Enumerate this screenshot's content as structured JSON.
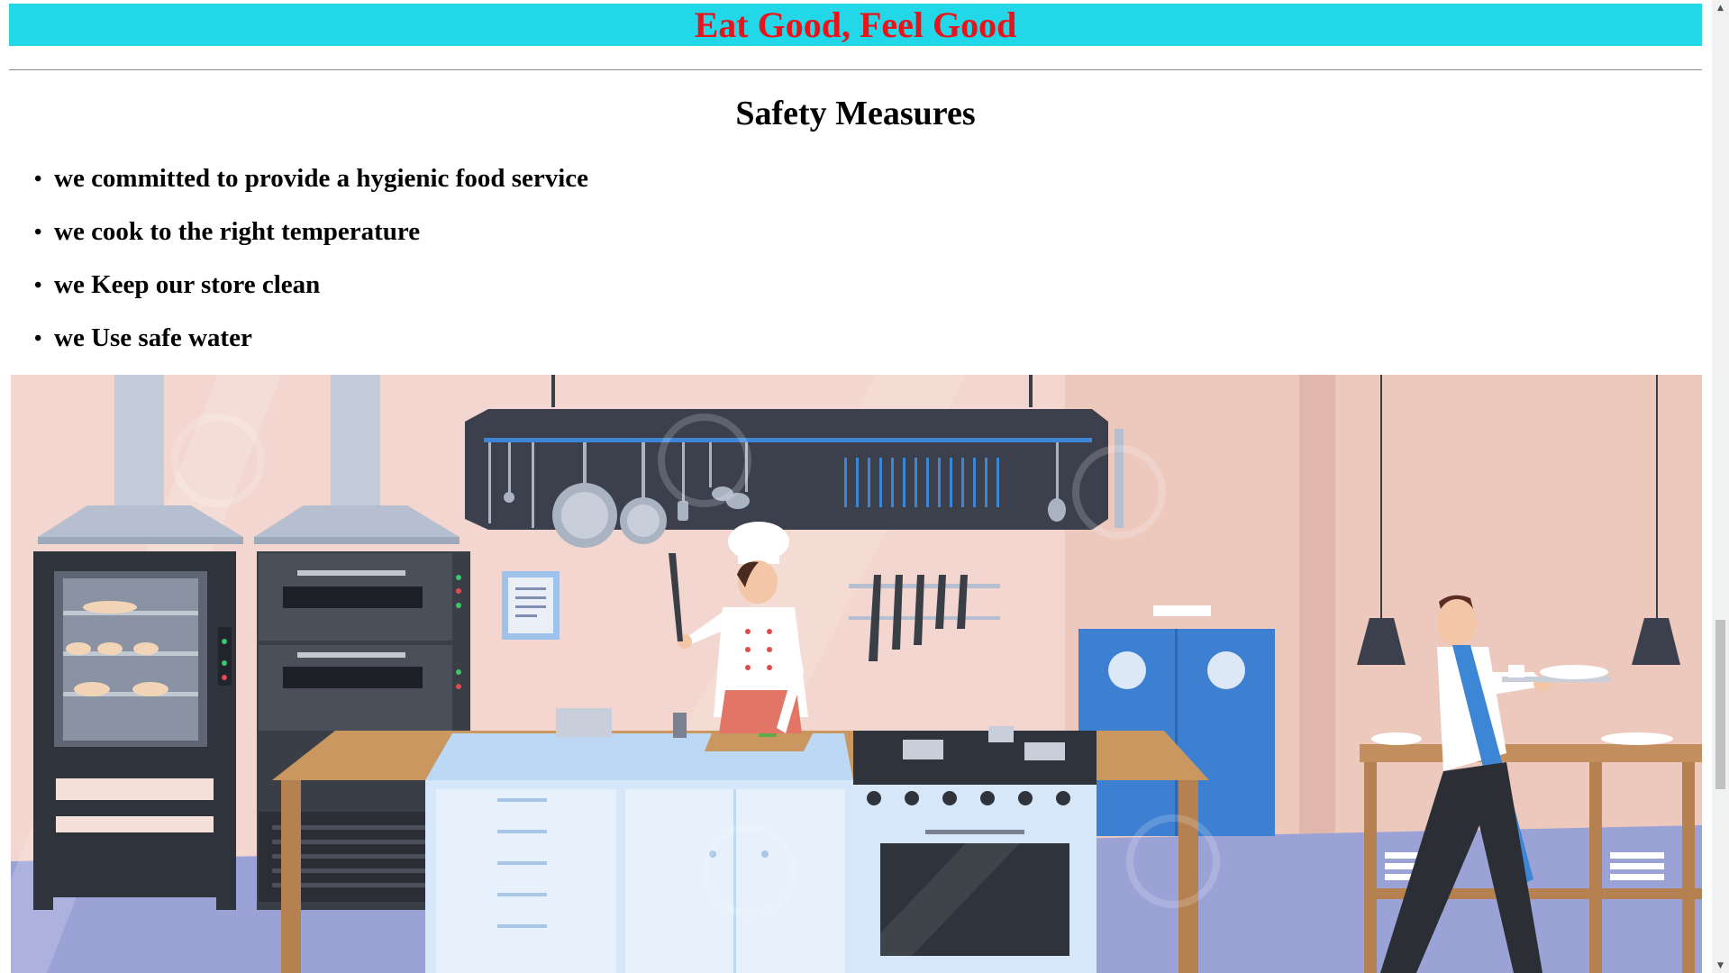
{
  "header": {
    "title": "Eat Good, Feel Good"
  },
  "safety": {
    "title": "Safety Measures",
    "items": [
      {
        "label": "we committed to provide a hygienic food service"
      },
      {
        "label": "we cook to the right temperature"
      },
      {
        "label": "we Keep our store clean"
      },
      {
        "label": "we Use safe water"
      }
    ],
    "bullet": "•"
  },
  "illustration": {
    "subject": "restaurant kitchen with chef and waiter"
  },
  "scrollbar": {
    "up_arrow": "▲",
    "down_arrow": "▼"
  },
  "colors": {
    "banner_bg": "#22d8e8",
    "banner_text": "#e8141c",
    "wall": "#f3d6cf",
    "floor": "#9aa2d6"
  }
}
